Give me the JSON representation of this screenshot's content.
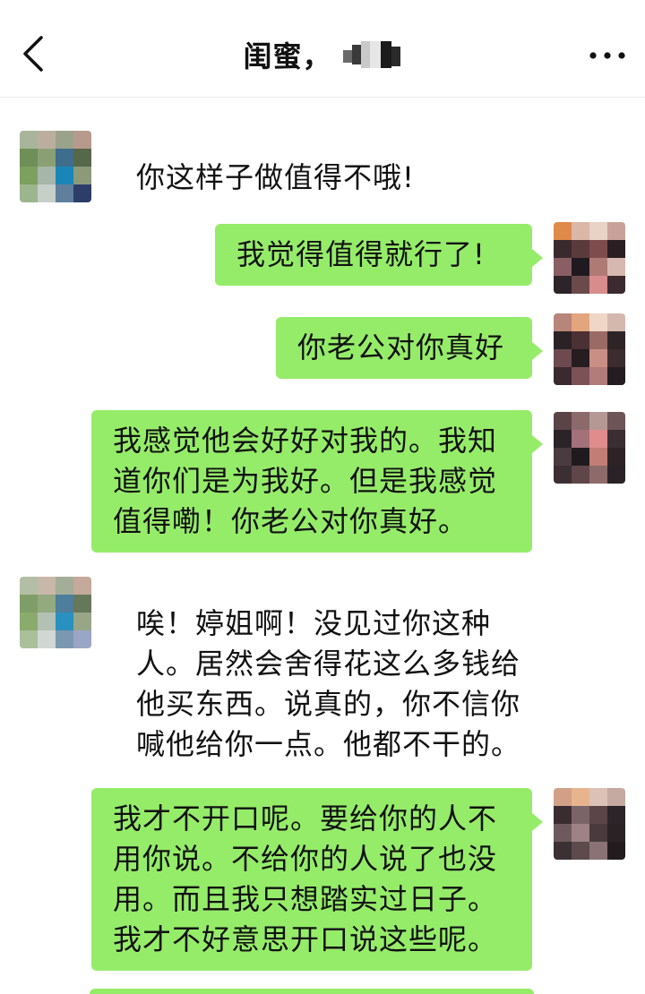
{
  "header": {
    "title": "闺蜜，",
    "back_icon": "chevron-left-icon",
    "more_icon": "more-dots-icon"
  },
  "colors": {
    "sent_bubble": "#95ec69",
    "received_bubble": "#ffffff",
    "background": "#ffffff"
  },
  "messages": [
    {
      "side": "received",
      "text": "你这样子做值得不哦!"
    },
    {
      "side": "sent",
      "text": "我觉得值得就行了!"
    },
    {
      "side": "sent",
      "text": "你老公对你真好"
    },
    {
      "side": "sent",
      "text": "我感觉他会好好对我的。我知道你们是为我好。但是我感觉值得嘞！你老公对你真好。"
    },
    {
      "side": "received",
      "text": "唉！婷姐啊！没见过你这种人。居然会舍得花这么多钱给他买东西。说真的，你不信你喊他给你一点。他都不干的。"
    },
    {
      "side": "sent",
      "text": "我才不开口呢。要给你的人不用你说。不给你的人说了也没用。而且我只想踏实过日子。我才不好意思开口说这些呢。"
    }
  ]
}
